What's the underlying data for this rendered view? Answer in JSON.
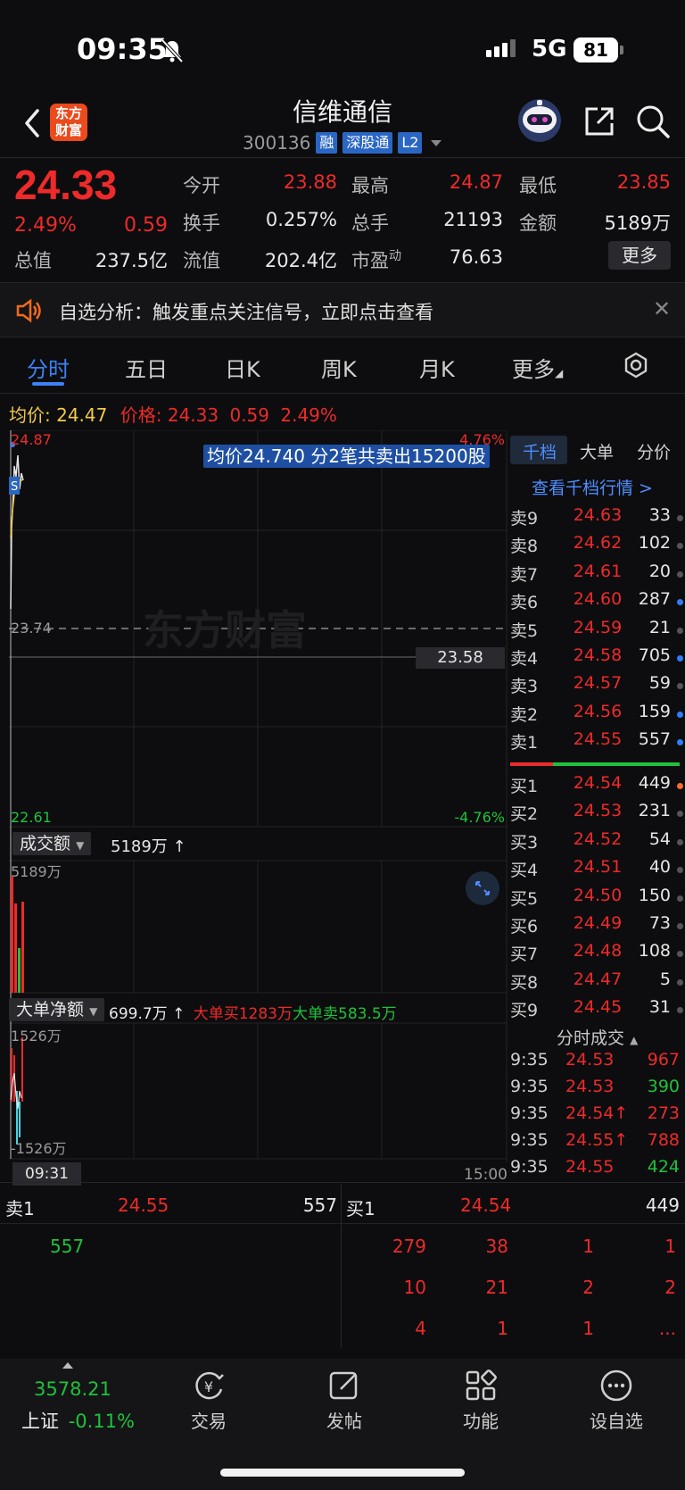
{
  "status_bar": {
    "time": "09:35",
    "network": "5G",
    "battery": "81"
  },
  "header": {
    "stock_name": "信维通信",
    "code": "300136",
    "tags": [
      "融",
      "深股通",
      "L2"
    ],
    "logo": "东方\n财富"
  },
  "quote": {
    "price": "24.33",
    "change_pct": "2.49%",
    "change": "0.59",
    "fields": [
      {
        "label": "今开",
        "value": "23.88",
        "color": "red"
      },
      {
        "label": "最高",
        "value": "24.87",
        "color": "red"
      },
      {
        "label": "最低",
        "value": "23.85",
        "color": "red"
      },
      {
        "label": "换手",
        "value": "0.257%",
        "color": "white"
      },
      {
        "label": "总手",
        "value": "21193",
        "color": "white"
      },
      {
        "label": "金额",
        "value": "5189万",
        "color": "white"
      },
      {
        "label": "总值",
        "value": "237.5亿",
        "color": "white"
      },
      {
        "label": "流值",
        "value": "202.4亿",
        "color": "white"
      },
      {
        "label": "市盈动",
        "value": "76.63",
        "color": "white"
      }
    ],
    "pe_label_main": "市盈",
    "pe_label_sup": "动",
    "more_label": "更多"
  },
  "notice": {
    "text": "自选分析：触发重点关注信号，立即点击查看"
  },
  "tabs": [
    "分时",
    "五日",
    "日K",
    "周K",
    "月K",
    "更多"
  ],
  "active_tab": "分时",
  "intraday": {
    "avg_label": "均价:",
    "avg_value": "24.47",
    "price_label": "价格:",
    "price_value": "24.33",
    "change": "0.59",
    "change_pct": "2.49%",
    "high_label": "24.87",
    "high_pct": "4.76%",
    "mid_label": "23.74",
    "low_label": "22.61",
    "low_pct": "-4.76%",
    "crosshair_price": "23.58",
    "tooltip": "均价24.740  分2笔共卖出15200股",
    "watermark": "东方财富",
    "start_time": "09:31",
    "end_time": "15:00"
  },
  "volume_panel": {
    "button": "成交额",
    "value": "5189万 ↑",
    "max_label": "5189万"
  },
  "bigorder_panel": {
    "button": "大单净额",
    "net": "699.7万 ↑",
    "buy": "大单买1283万",
    "sell": "大单卖583.5万",
    "top_label": "1526万",
    "bottom_label": "-1526万"
  },
  "order_book": {
    "tabs": [
      "千档",
      "大单",
      "分价"
    ],
    "link": "查看千档行情 >",
    "asks": [
      {
        "label": "卖9",
        "price": "24.63",
        "vol": "33",
        "dot": "#555555"
      },
      {
        "label": "卖8",
        "price": "24.62",
        "vol": "102",
        "dot": "#555555"
      },
      {
        "label": "卖7",
        "price": "24.61",
        "vol": "20",
        "dot": "#555555"
      },
      {
        "label": "卖6",
        "price": "24.60",
        "vol": "287",
        "dot": "#2f7dff"
      },
      {
        "label": "卖5",
        "price": "24.59",
        "vol": "21",
        "dot": "#555555"
      },
      {
        "label": "卖4",
        "price": "24.58",
        "vol": "705",
        "dot": "#2f7dff"
      },
      {
        "label": "卖3",
        "price": "24.57",
        "vol": "59",
        "dot": "#555555"
      },
      {
        "label": "卖2",
        "price": "24.56",
        "vol": "159",
        "dot": "#2f7dff"
      },
      {
        "label": "卖1",
        "price": "24.55",
        "vol": "557",
        "dot": "#2f7dff"
      }
    ],
    "bids": [
      {
        "label": "买1",
        "price": "24.54",
        "vol": "449",
        "dot": "#ff6a2a"
      },
      {
        "label": "买2",
        "price": "24.53",
        "vol": "231",
        "dot": "#555555"
      },
      {
        "label": "买3",
        "price": "24.52",
        "vol": "54",
        "dot": "#555555"
      },
      {
        "label": "买4",
        "price": "24.51",
        "vol": "40",
        "dot": "#555555"
      },
      {
        "label": "买5",
        "price": "24.50",
        "vol": "150",
        "dot": "#555555"
      },
      {
        "label": "买6",
        "price": "24.49",
        "vol": "73",
        "dot": "#555555"
      },
      {
        "label": "买7",
        "price": "24.48",
        "vol": "108",
        "dot": "#555555"
      },
      {
        "label": "买8",
        "price": "24.47",
        "vol": "5",
        "dot": "#555555"
      },
      {
        "label": "买9",
        "price": "24.45",
        "vol": "31",
        "dot": "#555555"
      }
    ]
  },
  "ticks": {
    "header": "分时成交",
    "rows": [
      {
        "time": "9:35",
        "price": "24.53",
        "vol": "967",
        "color": "red"
      },
      {
        "time": "9:35",
        "price": "24.53",
        "vol": "390",
        "color": "green"
      },
      {
        "time": "9:35",
        "price": "24.54↑",
        "vol": "273",
        "color": "red"
      },
      {
        "time": "9:35",
        "price": "24.55↑",
        "vol": "788",
        "color": "red"
      },
      {
        "time": "9:35",
        "price": "24.55",
        "vol": "424",
        "color": "green"
      }
    ]
  },
  "queue": {
    "sell_label": "卖1",
    "sell_price": "24.55",
    "sell_vol": "557",
    "buy_label": "买1",
    "buy_price": "24.54",
    "buy_vol": "449",
    "sell_orders": [
      "557"
    ],
    "buy_orders": [
      [
        "279",
        "38",
        "1",
        "1"
      ],
      [
        "10",
        "21",
        "2",
        "2"
      ],
      [
        "4",
        "1",
        "1",
        "..."
      ]
    ]
  },
  "bottom_bar": {
    "index_value": "3578.21",
    "index_name": "上证",
    "index_change": "-0.11%",
    "items": [
      "交易",
      "发帖",
      "功能",
      "设自选"
    ]
  },
  "colors": {
    "up": "#ee2a2a",
    "down": "#1fc23b",
    "accent": "#3b82f6",
    "avg": "#f2c94c"
  }
}
